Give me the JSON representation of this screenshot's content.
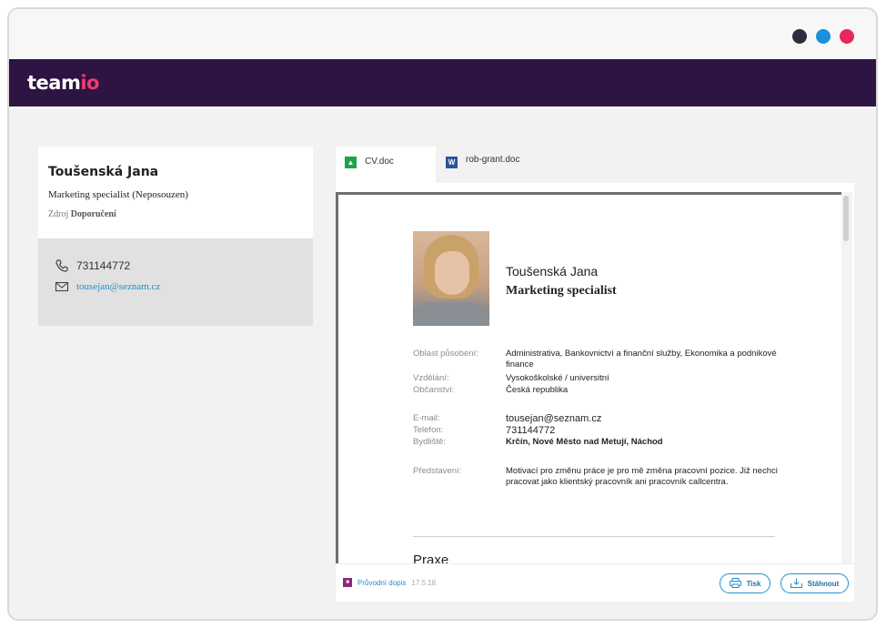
{
  "window": {
    "dots": [
      {
        "name": "dot-dark",
        "color": "#2e2c3f"
      },
      {
        "name": "dot-blue",
        "color": "#1a8fdc"
      },
      {
        "name": "dot-pink",
        "color": "#e8275d"
      }
    ]
  },
  "brand": {
    "logo_main": "team",
    "logo_accent": "io",
    "bar_color": "#2d1443",
    "accent_color": "#ee3b72"
  },
  "candidate": {
    "name": "Toušenská Jana",
    "position": "Marketing specialist (Neposouzen)",
    "source_label": "Zdroj",
    "source_value": "Doporučení",
    "phone": "731144772",
    "email": "tousejan@seznam.cz"
  },
  "tabs": [
    {
      "label": "CV.doc",
      "icon": "image-file-icon",
      "active": true
    },
    {
      "label": "rob-grant.doc",
      "icon": "word-file-icon",
      "active": false
    }
  ],
  "cv": {
    "name": "Toušenská Jana",
    "title": "Marketing specialist",
    "fields": [
      {
        "key": "Oblast působení:",
        "value": "Administrativa, Bankovnictví a finanční služby, Ekonomika a podnikové finance"
      },
      {
        "key": "Vzdělání:",
        "value": "Vysokoškolské / universitní"
      },
      {
        "key": "Občanství:",
        "value": "Česká republika"
      },
      {
        "key": "E-mail:",
        "value": "tousejan@seznam.cz"
      },
      {
        "key": "Telefon:",
        "value": "731144772"
      },
      {
        "key": "Bydliště:",
        "value": "Krčín, Nové Město nad Metují, Náchod"
      },
      {
        "key": "Představení:",
        "value": "Motivací pro změnu práce je pro mě změna pracovní pozice. Již nechci pracovat jako klientský pracovník ani pracovník callcentra."
      }
    ],
    "section_heading": "Praxe"
  },
  "footer": {
    "attachment_label": "Průvodní dopis",
    "attachment_date": "17.5.18",
    "print_label": "Tisk",
    "download_label": "Stáhnout"
  }
}
